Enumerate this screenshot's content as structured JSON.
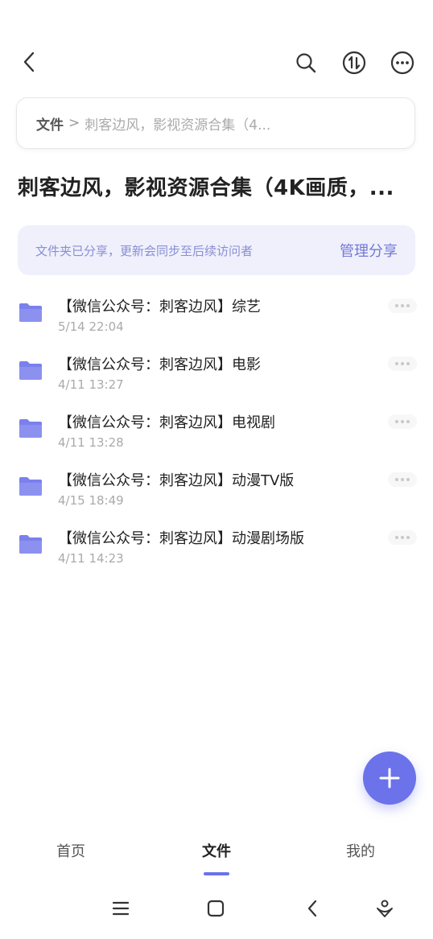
{
  "header": {
    "back_icon": "chevron-left-icon",
    "search_icon": "search-icon",
    "sort_icon": "sort-icon",
    "more_icon": "more-icon"
  },
  "breadcrumb": {
    "root": "文件",
    "separator": ">",
    "current": "刺客边风，影视资源合集（4..."
  },
  "page_title": "刺客边风，影视资源合集（4K画质，...",
  "share_banner": {
    "message": "文件夹已分享，更新会同步至后续访问者",
    "action": "管理分享"
  },
  "files": [
    {
      "name": "【微信公众号：刺客边风】综艺",
      "date": "5/14 22:04"
    },
    {
      "name": "【微信公众号：刺客边风】电影",
      "date": "4/11 13:27"
    },
    {
      "name": "【微信公众号：刺客边风】电视剧",
      "date": "4/11 13:28"
    },
    {
      "name": "【微信公众号：刺客边风】动漫TV版",
      "date": "4/15 18:49"
    },
    {
      "name": "【微信公众号：刺客边风】动漫剧场版",
      "date": "4/11 14:23"
    }
  ],
  "tabs": [
    {
      "label": "首页"
    },
    {
      "label": "文件",
      "active": true
    },
    {
      "label": "我的"
    }
  ],
  "colors": {
    "accent": "#6b72ea",
    "banner_bg": "#eff0fb",
    "folder": "#7a80ec"
  }
}
